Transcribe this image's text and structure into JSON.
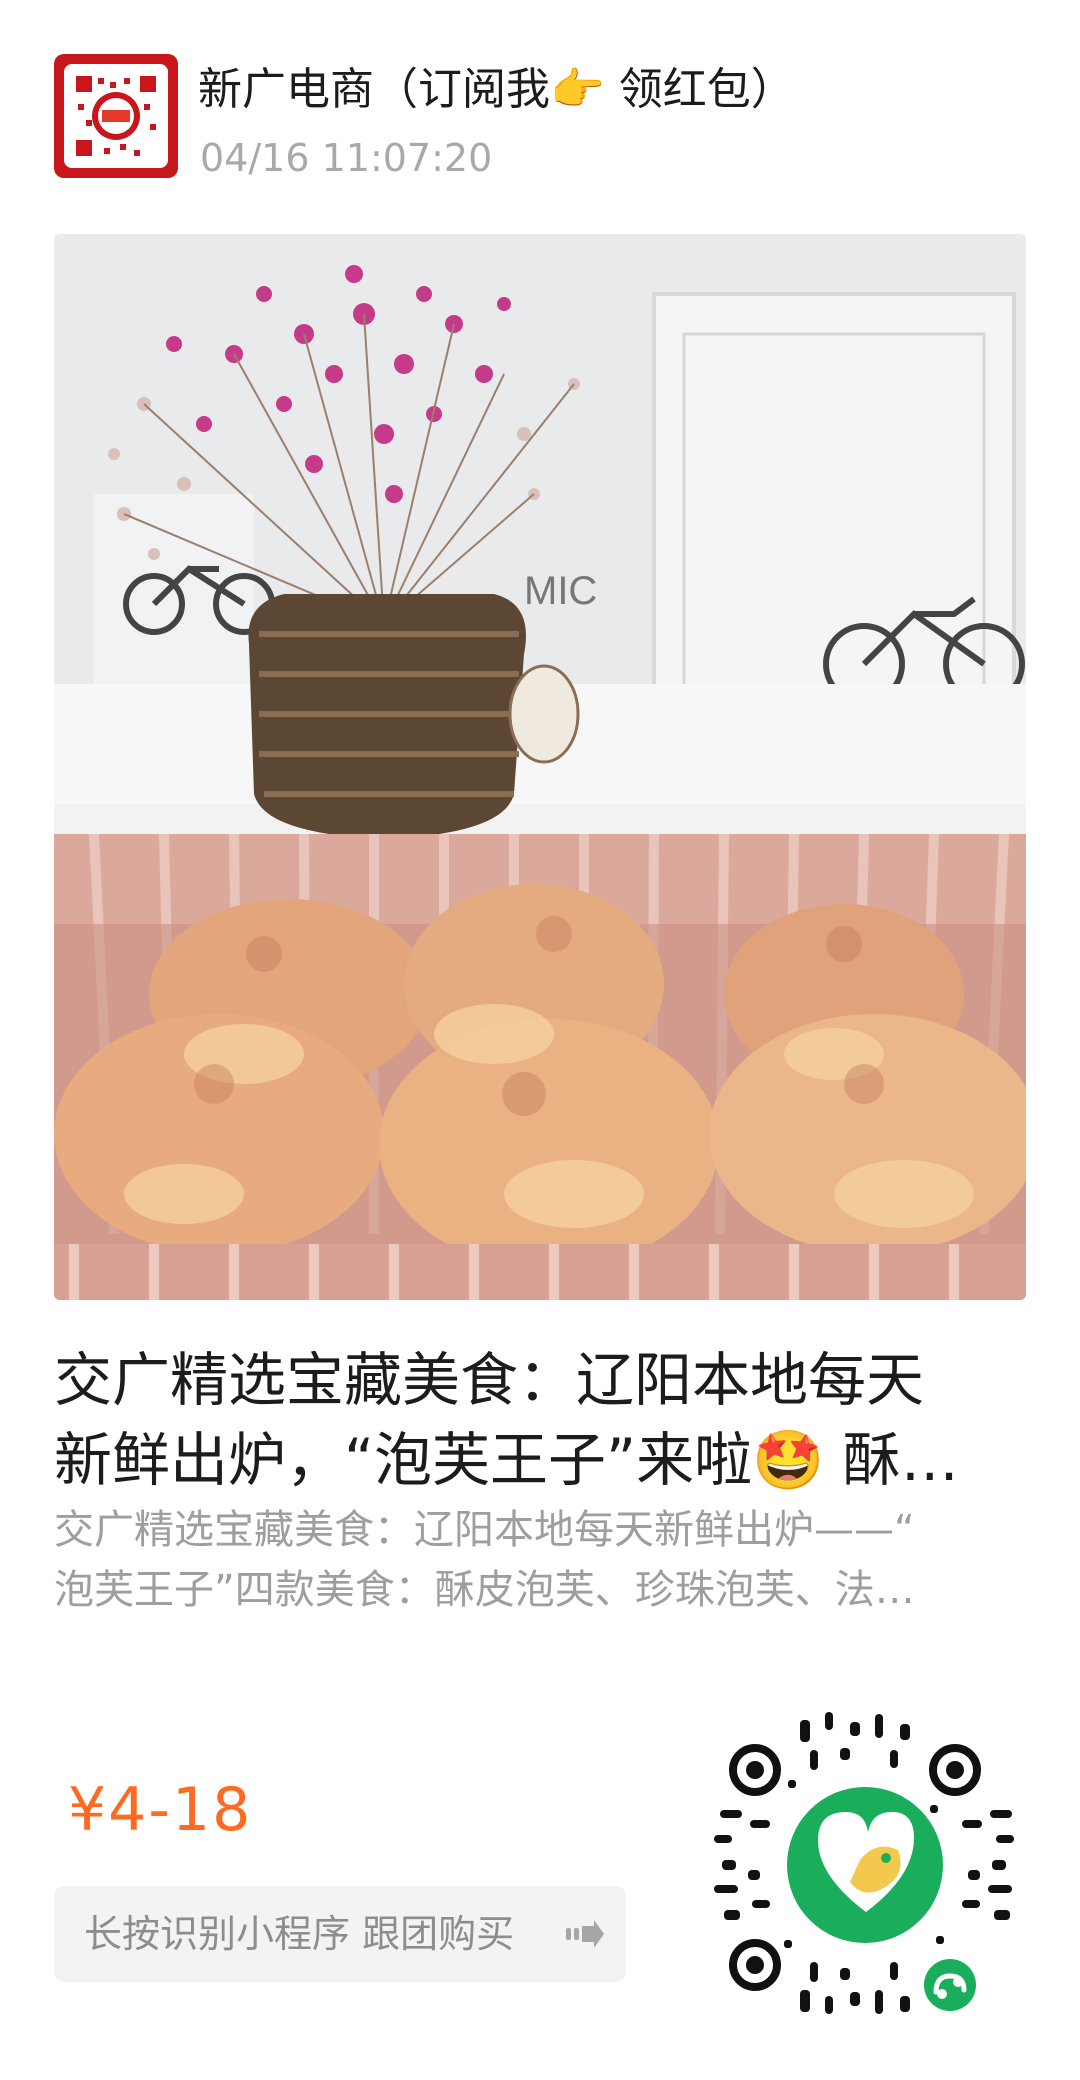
{
  "account": {
    "name": "新广电商（订阅我👉 领红包）",
    "timestamp": "04/16 11:07:20"
  },
  "article": {
    "title_line1": "交广精选宝藏美食：辽阳本地每天",
    "title_line2": "新鲜出炉，“泡芙王子”来啦🤩 酥…",
    "desc_line1": "交广精选宝藏美食：辽阳本地每天新鲜出炉——“",
    "desc_line2": "泡芙王子”四款美食：酥皮泡芙、珍珠泡芙、法…"
  },
  "product": {
    "price": "¥4-18",
    "cta_label": "长按识别小程序 跟团购买"
  },
  "colors": {
    "price": "#ff6a21",
    "avatar_red": "#c8161d",
    "miniprogram_green": "#1aad5c"
  },
  "icons": {
    "cta": "arrow-right-icon",
    "qr_center": "miniprogram-logo-icon"
  }
}
